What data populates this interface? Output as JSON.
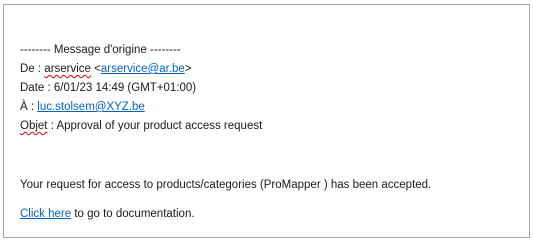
{
  "header": {
    "separator": "-------- Message d'origine --------",
    "from_label": "De : ",
    "from_name": "arservice",
    "from_email": "arservice@ar.be",
    "date_label": "Date : ",
    "date_value": "6/01/23 14:49 (GMT+01:00)",
    "to_label": "À : ",
    "to_email": "luc.stolsem@XYZ.be",
    "subject_label": "Objet",
    "subject_value": " : Approval of your product access request"
  },
  "body": {
    "message": "Your request for access to products/categories (ProMapper ) has been accepted.",
    "link_text": "Click here",
    "link_suffix": " to go to documentation."
  },
  "colors": {
    "link": "#0563c1",
    "spellcheck": "#e00000",
    "border": "#a6a6a6"
  }
}
